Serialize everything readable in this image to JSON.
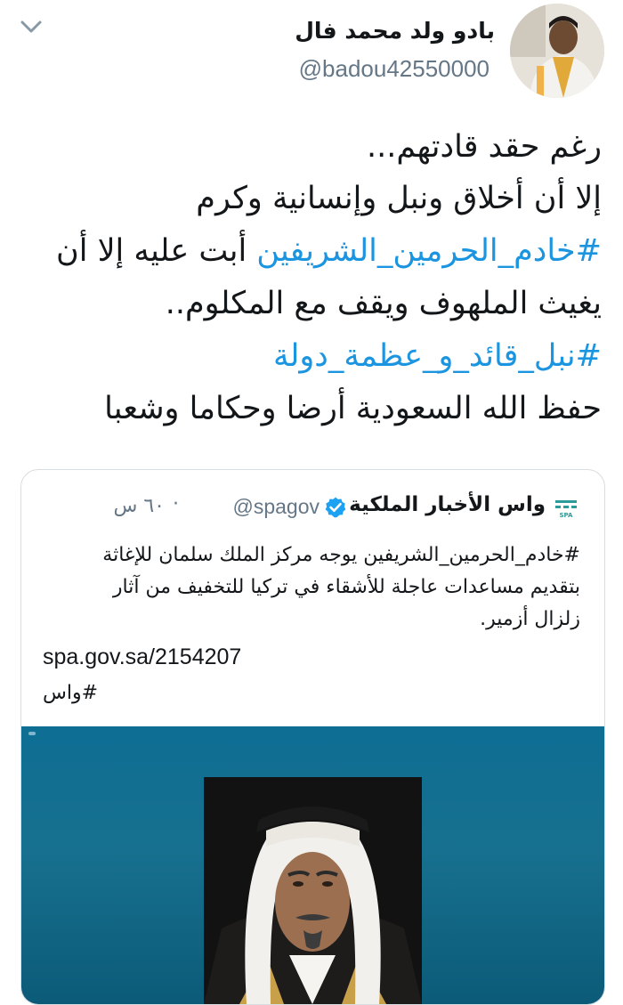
{
  "header": {
    "display_name": "بادو ولد محمد فال",
    "handle": "@badou42550000",
    "chevron_icon": "chevron-down-icon",
    "avatar_icon": "user-avatar"
  },
  "tweet": {
    "lines": [
      {
        "text": "رغم حقد قادتهم...",
        "hashtag": ""
      },
      {
        "text": "إلا أن أخلاق ونبل وإنسانية وكرم",
        "hashtag": ""
      },
      {
        "hashtag": "#خادم_الحرمين_الشريفين",
        "text": " أبت عليه إلا أن"
      },
      {
        "text": "يغيث الملهوف ويقف مع المكلوم..",
        "hashtag": ""
      },
      {
        "hashtag": "#نبل_قائد_و_عظمة_دولة",
        "text": ""
      },
      {
        "text": "حفظ الله السعودية أرضا وحكاما وشعبا",
        "hashtag": ""
      }
    ]
  },
  "quote": {
    "name": "واس الأخبار الملكية",
    "handle": "@spagov",
    "dot": "·",
    "time": "٦٠ س",
    "body_lines": [
      "#خادم_الحرمين_الشريفين يوجه مركز الملك سلمان للإغاثة",
      "بتقديم مساعدات عاجلة للأشقاء في تركيا للتخفيف من آثار",
      "زلزال أزمير."
    ],
    "link": "spa.gov.sa/2154207",
    "tag": "#واس",
    "logo_icon": "spa-logo-icon",
    "verified_icon": "verified-badge-icon"
  },
  "colors": {
    "text": "#14171a",
    "secondary": "#657786",
    "hashtag": "#1b95e0",
    "image_bg": "#0e6e94"
  }
}
